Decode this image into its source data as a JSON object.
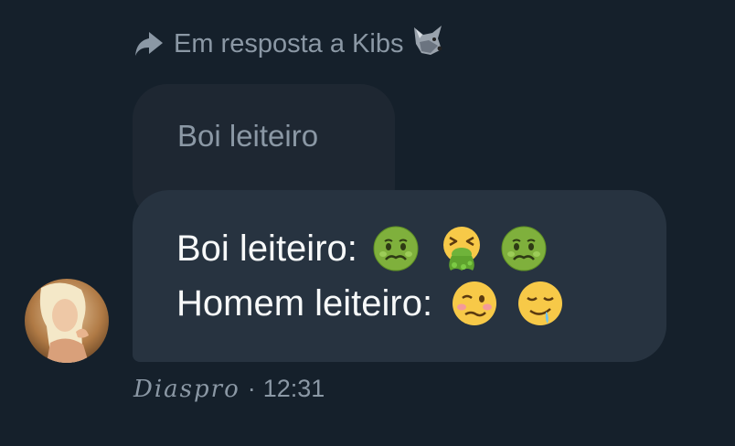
{
  "reply_header": {
    "text": "Em resposta a Kibs",
    "icons": [
      "reply-arrow-icon",
      "wolf-emoji-icon"
    ]
  },
  "quoted_message": {
    "text": "Boi leiteiro"
  },
  "message": {
    "line1_text": "Boi leiteiro:",
    "line1_emojis": [
      "nauseated-face",
      "face-vomiting",
      "nauseated-face"
    ],
    "line2_text": "Homem leiteiro:",
    "line2_emojis": [
      "woozy-face",
      "drooling-face"
    ]
  },
  "meta": {
    "sender": "Diaspro",
    "separator": "·",
    "time": "12:31"
  },
  "colors": {
    "background": "#15202b",
    "quoted_bubble": "#1e2732",
    "message_bubble": "#273340",
    "primary_text": "#f7f9f9",
    "secondary_text": "#8b98a5"
  }
}
